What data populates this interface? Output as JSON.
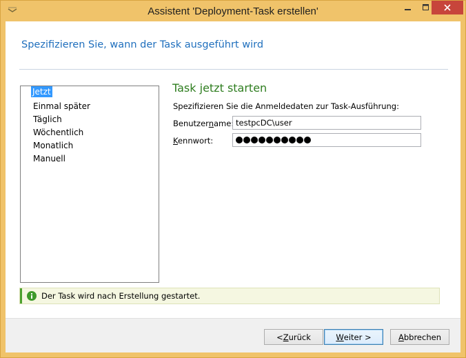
{
  "window": {
    "title": "Assistent 'Deployment-Task erstellen'"
  },
  "header": {
    "title": "Spezifizieren Sie, wann der Task ausgeführt wird"
  },
  "schedule_options": [
    {
      "label": "Jetzt",
      "selected": true
    },
    {
      "label": "Einmal später",
      "selected": false
    },
    {
      "label": "Täglich",
      "selected": false
    },
    {
      "label": "Wöchentlich",
      "selected": false
    },
    {
      "label": "Monatlich",
      "selected": false
    },
    {
      "label": "Manuell",
      "selected": false
    }
  ],
  "panel": {
    "title": "Task jetzt starten",
    "description": "Spezifizieren Sie die Anmeldedaten zur Task-Ausführung:",
    "username": {
      "label_prefix": "Benutzer",
      "label_mnemonic": "n",
      "label_suffix": "ame:",
      "value": "testpcDC\\user"
    },
    "password": {
      "label_mnemonic": "K",
      "label_suffix": "ennwort:",
      "masked_length": 10
    }
  },
  "info": {
    "icon": "info-icon",
    "text": "Der Task wird nach Erstellung gestartet."
  },
  "buttons": {
    "back": {
      "prefix": "< ",
      "mnemonic": "Z",
      "suffix": "urück"
    },
    "next": {
      "mnemonic": "W",
      "suffix": "eiter >"
    },
    "cancel": {
      "mnemonic": "A",
      "suffix": "bbrechen"
    }
  },
  "colors": {
    "titlebar": "#f0c36a",
    "header_text": "#1f6fbd",
    "section_title": "#2e7d1f",
    "selection": "#3399ff",
    "close_button": "#c7453b",
    "info_accent": "#4ca12f"
  }
}
